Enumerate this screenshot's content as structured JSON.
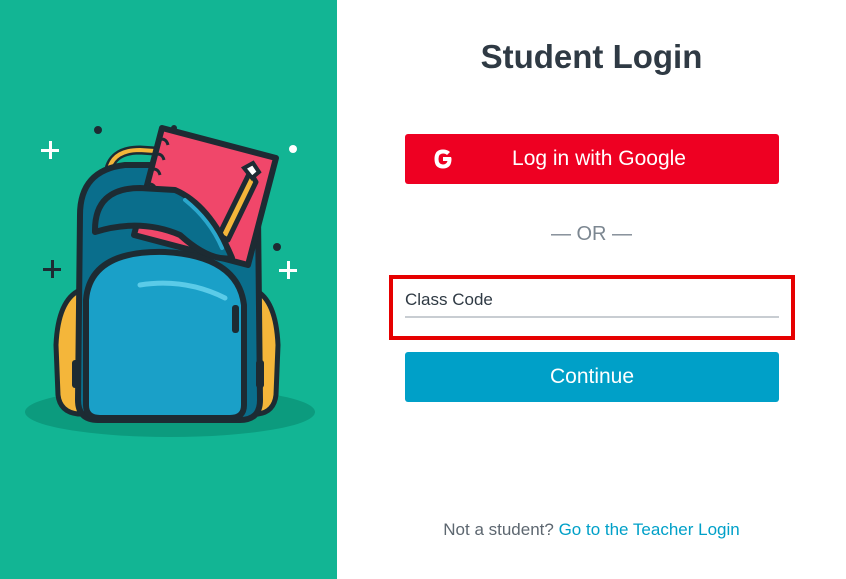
{
  "left_panel": {
    "background": "#12b594",
    "illustration": "backpack-illustration"
  },
  "login": {
    "title": "Student Login",
    "google_button_label": "Log in with Google",
    "google_icon_letter": "G",
    "divider_text": "— OR —",
    "class_code_placeholder": "Class Code",
    "continue_label": "Continue"
  },
  "footer": {
    "prompt": "Not a student?",
    "link": "Go to the Teacher Login"
  },
  "colors": {
    "google_red": "#ee0022",
    "continue_blue": "#00a0c8",
    "link_blue": "#00a0c8",
    "highlight_red": "#e60000"
  }
}
